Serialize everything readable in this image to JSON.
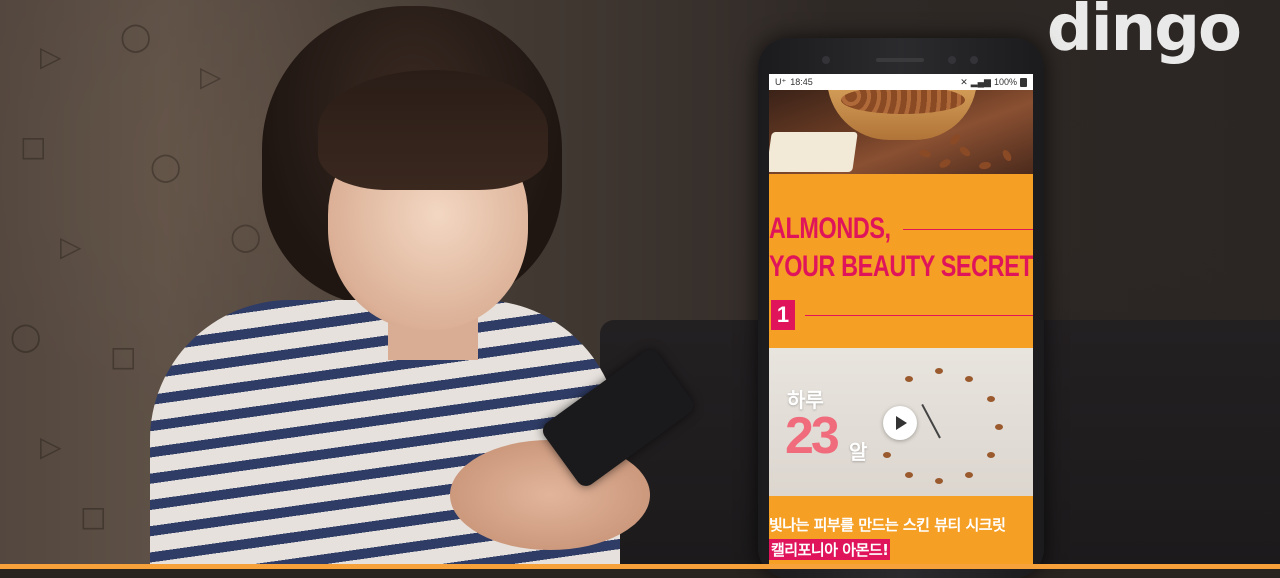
{
  "brand": {
    "logo": "dingo"
  },
  "phone": {
    "status": {
      "carrier": "U⁺",
      "time": "18:45",
      "battery": "100%",
      "signal_icon": "signal-icon"
    },
    "promo": {
      "title_line1": "ALMONDS,",
      "title_line2": "YOUR BEAUTY SECRET",
      "badge": "1"
    },
    "video": {
      "label_top": "하루",
      "number": "23",
      "unit": "알",
      "play_icon": "play-icon"
    },
    "caption": {
      "line1": "빛나는 피부를 만드는 스킨 뷰티 시크릿",
      "line2": "캘리포니아 아몬드!"
    }
  },
  "colors": {
    "accent_pink": "#e0145a",
    "orange": "#f59f24",
    "number_pink": "#f06c7d"
  }
}
